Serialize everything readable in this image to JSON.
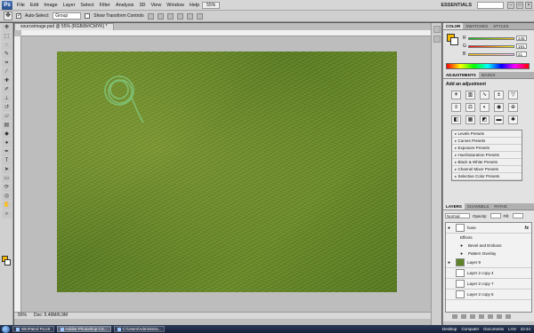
{
  "app": {
    "logo_text": "Ps"
  },
  "menu": {
    "items": [
      "File",
      "Edit",
      "Image",
      "Layer",
      "Select",
      "Filter",
      "Analysis",
      "3D",
      "View",
      "Window",
      "Help"
    ],
    "zoom_value": "55%",
    "workspace": "ESSENTIALS"
  },
  "options": {
    "auto_select_label": "Auto-Select:",
    "auto_select_value": "Group",
    "show_transform_label": "Show Transform Controls"
  },
  "document": {
    "tab_title": "sourceimage.psd @ 55% (RGB/8#/CMYK) *",
    "status_zoom": "55%",
    "status_doc": "Doc: 5.49M/6.9M"
  },
  "color_panel": {
    "tabs": [
      "COLOR",
      "SWATCHES",
      "STYLES"
    ],
    "fg_color": "#f5b800",
    "bg_color": "#ffffff",
    "channels": [
      {
        "label": "R",
        "value": "245"
      },
      {
        "label": "G",
        "value": "191"
      },
      {
        "label": "B",
        "value": "21"
      }
    ]
  },
  "adjustments_panel": {
    "tabs": [
      "ADJUSTMENTS",
      "MASKS"
    ],
    "title": "Add an adjustment",
    "presets": [
      "Levels Presets",
      "Curves Presets",
      "Exposure Presets",
      "Hue/Saturation Presets",
      "Black & White Presets",
      "Channel Mixer Presets",
      "Selective Color Presets"
    ]
  },
  "layers_panel": {
    "tabs": [
      "LAYERS",
      "CHANNELS",
      "PATHS"
    ],
    "blend_mode": "Normal",
    "opacity_label": "Opacity:",
    "fill_label": "Fill:",
    "layers": [
      {
        "name": "hose",
        "visible": true,
        "fx": "fx",
        "thumb": "white"
      },
      {
        "name": "Effects",
        "effect": true
      },
      {
        "name": "Bevel and Emboss",
        "effect": true
      },
      {
        "name": "Pattern Overlay",
        "effect": true
      },
      {
        "name": "Layer 9",
        "visible": true,
        "thumb": "green"
      },
      {
        "name": "Layer 2 copy 4",
        "visible": false,
        "thumb": "white"
      },
      {
        "name": "Layer 2 copy 7",
        "visible": false,
        "thumb": "white"
      },
      {
        "name": "Layer 2 copy 6",
        "visible": false,
        "thumb": "white"
      }
    ]
  },
  "taskbar": {
    "items": [
      "WinPatrol PLUS",
      "Adobe Photoshop CS...",
      "C:\\Users\\Administra..."
    ],
    "tray_items": [
      "Desktop",
      "Computer",
      "Documents",
      "LAN"
    ],
    "clock": "22:44"
  }
}
